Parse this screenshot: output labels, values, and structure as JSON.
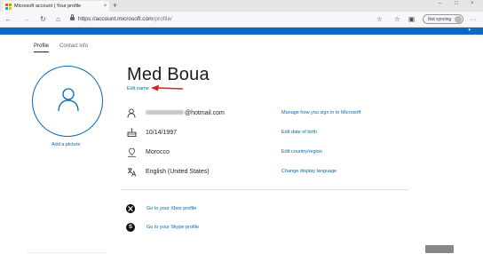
{
  "browser": {
    "tab_title": "Microsoft account | Your profile",
    "tab_close": "×",
    "new_tab": "+",
    "window_controls": [
      "–",
      "□",
      "×"
    ],
    "url_host": "https://account.microsoft.com",
    "url_path": "/profile/",
    "sync_label": "Not syncing",
    "more": "···"
  },
  "profile_nav": {
    "tabs": [
      {
        "label": "Profile",
        "active": true
      },
      {
        "label": "Contact info",
        "active": false
      }
    ]
  },
  "profile": {
    "name": "Med Boua",
    "edit_name": "Edit name",
    "add_picture": "Add a picture"
  },
  "info_rows": [
    {
      "icon": "person-icon",
      "value_suffix": "@hotmail.com",
      "link": "Manage how you sign in to Microsoft"
    },
    {
      "icon": "cake-icon",
      "value": "10/14/1997",
      "link": "Edit date of birth"
    },
    {
      "icon": "location-icon",
      "value": "Morocco",
      "link": "Edit country/region"
    },
    {
      "icon": "language-icon",
      "value": "English (United States)",
      "link": "Change display language"
    }
  ],
  "services": [
    {
      "icon": "xbox-icon",
      "link": "Go to your Xbox profile"
    },
    {
      "icon": "skype-icon",
      "glyph": "S",
      "link": "Go to your Skype profile"
    }
  ],
  "colors": {
    "accent": "#0067b8",
    "banner": "#0a6bc7",
    "annotation_arrow": "#d92020"
  }
}
